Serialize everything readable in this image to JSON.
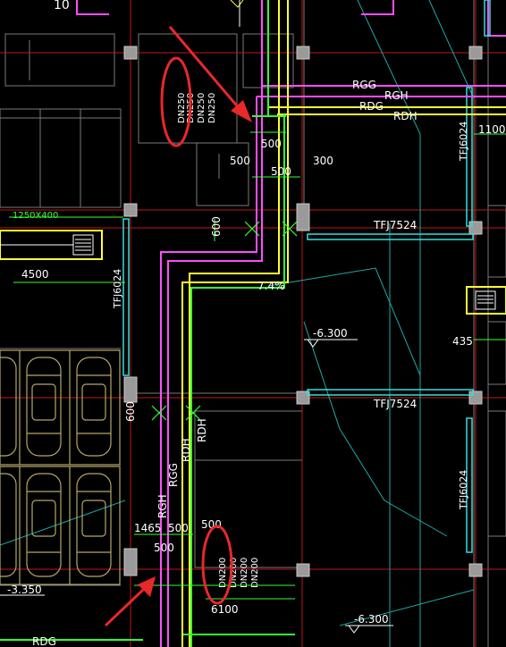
{
  "drawing": {
    "top_left_number": "10",
    "pipes": {
      "rgg": "RGG",
      "rgh": "RGH",
      "rdg": "RDG",
      "rdh": "RDH",
      "rgh_vertical": "RGH",
      "rgg_vertical": "RGG",
      "rdh_vertical": "RDH",
      "rdh_vertical_2": "RDH",
      "rdg_bottom": "RDG"
    },
    "pipe_sizes_top": [
      "DN250",
      "DN250",
      "DN250",
      "DN250"
    ],
    "pipe_sizes_bottom": [
      "DN200",
      "DN200",
      "DN200",
      "DN200"
    ],
    "dimensions": {
      "d500_a": "500",
      "d500_b": "500",
      "d500_c": "500",
      "d300": "300",
      "d600_a": "600",
      "d600_b": "600",
      "d1100": "1100",
      "d4500": "4500",
      "d435": "435",
      "d1465": "1465",
      "d500_d": "500",
      "d500_e": "500",
      "d500_f": "500",
      "d6100": "6100"
    },
    "ducts": {
      "tfj7524_top": "TFJ7524",
      "tfj7524_mid": "TFJ7524",
      "tfj6024_left": "TFJ6024",
      "tfj6024_right_top": "TFJ6024",
      "tfj6024_right_bottom": "TFJ6024",
      "duct_size": "1250X400"
    },
    "slope": "7.4%",
    "elevations": {
      "elev_mid": "-6.300",
      "elev_bottom": "-6.300",
      "elev_left": "-3.350"
    }
  },
  "colors": {
    "background": "#000000",
    "magenta": "#ff4dff",
    "yellow": "#ffff33",
    "green": "#33ff33",
    "cyan": "#33e0e0",
    "red": "#e02020",
    "white": "#ffffff",
    "grey": "#808080",
    "annotation_red": "#e8282a",
    "car_outline": "#b5a66a"
  }
}
